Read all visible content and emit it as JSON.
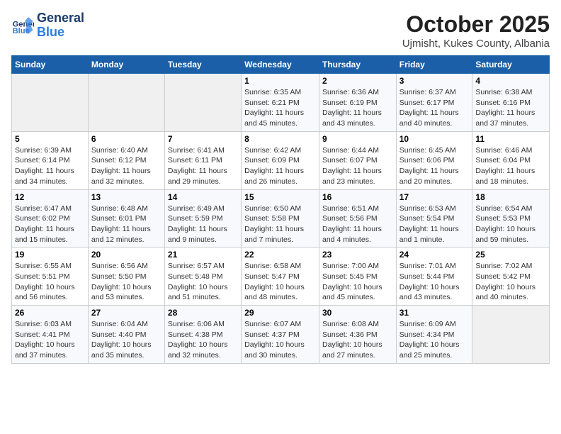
{
  "header": {
    "logo_general": "General",
    "logo_blue": "Blue",
    "title": "October 2025",
    "subtitle": "Ujmisht, Kukes County, Albania"
  },
  "weekdays": [
    "Sunday",
    "Monday",
    "Tuesday",
    "Wednesday",
    "Thursday",
    "Friday",
    "Saturday"
  ],
  "weeks": [
    [
      {
        "day": "",
        "info": ""
      },
      {
        "day": "",
        "info": ""
      },
      {
        "day": "",
        "info": ""
      },
      {
        "day": "1",
        "info": "Sunrise: 6:35 AM\nSunset: 6:21 PM\nDaylight: 11 hours and 45 minutes."
      },
      {
        "day": "2",
        "info": "Sunrise: 6:36 AM\nSunset: 6:19 PM\nDaylight: 11 hours and 43 minutes."
      },
      {
        "day": "3",
        "info": "Sunrise: 6:37 AM\nSunset: 6:17 PM\nDaylight: 11 hours and 40 minutes."
      },
      {
        "day": "4",
        "info": "Sunrise: 6:38 AM\nSunset: 6:16 PM\nDaylight: 11 hours and 37 minutes."
      }
    ],
    [
      {
        "day": "5",
        "info": "Sunrise: 6:39 AM\nSunset: 6:14 PM\nDaylight: 11 hours and 34 minutes."
      },
      {
        "day": "6",
        "info": "Sunrise: 6:40 AM\nSunset: 6:12 PM\nDaylight: 11 hours and 32 minutes."
      },
      {
        "day": "7",
        "info": "Sunrise: 6:41 AM\nSunset: 6:11 PM\nDaylight: 11 hours and 29 minutes."
      },
      {
        "day": "8",
        "info": "Sunrise: 6:42 AM\nSunset: 6:09 PM\nDaylight: 11 hours and 26 minutes."
      },
      {
        "day": "9",
        "info": "Sunrise: 6:44 AM\nSunset: 6:07 PM\nDaylight: 11 hours and 23 minutes."
      },
      {
        "day": "10",
        "info": "Sunrise: 6:45 AM\nSunset: 6:06 PM\nDaylight: 11 hours and 20 minutes."
      },
      {
        "day": "11",
        "info": "Sunrise: 6:46 AM\nSunset: 6:04 PM\nDaylight: 11 hours and 18 minutes."
      }
    ],
    [
      {
        "day": "12",
        "info": "Sunrise: 6:47 AM\nSunset: 6:02 PM\nDaylight: 11 hours and 15 minutes."
      },
      {
        "day": "13",
        "info": "Sunrise: 6:48 AM\nSunset: 6:01 PM\nDaylight: 11 hours and 12 minutes."
      },
      {
        "day": "14",
        "info": "Sunrise: 6:49 AM\nSunset: 5:59 PM\nDaylight: 11 hours and 9 minutes."
      },
      {
        "day": "15",
        "info": "Sunrise: 6:50 AM\nSunset: 5:58 PM\nDaylight: 11 hours and 7 minutes."
      },
      {
        "day": "16",
        "info": "Sunrise: 6:51 AM\nSunset: 5:56 PM\nDaylight: 11 hours and 4 minutes."
      },
      {
        "day": "17",
        "info": "Sunrise: 6:53 AM\nSunset: 5:54 PM\nDaylight: 11 hours and 1 minute."
      },
      {
        "day": "18",
        "info": "Sunrise: 6:54 AM\nSunset: 5:53 PM\nDaylight: 10 hours and 59 minutes."
      }
    ],
    [
      {
        "day": "19",
        "info": "Sunrise: 6:55 AM\nSunset: 5:51 PM\nDaylight: 10 hours and 56 minutes."
      },
      {
        "day": "20",
        "info": "Sunrise: 6:56 AM\nSunset: 5:50 PM\nDaylight: 10 hours and 53 minutes."
      },
      {
        "day": "21",
        "info": "Sunrise: 6:57 AM\nSunset: 5:48 PM\nDaylight: 10 hours and 51 minutes."
      },
      {
        "day": "22",
        "info": "Sunrise: 6:58 AM\nSunset: 5:47 PM\nDaylight: 10 hours and 48 minutes."
      },
      {
        "day": "23",
        "info": "Sunrise: 7:00 AM\nSunset: 5:45 PM\nDaylight: 10 hours and 45 minutes."
      },
      {
        "day": "24",
        "info": "Sunrise: 7:01 AM\nSunset: 5:44 PM\nDaylight: 10 hours and 43 minutes."
      },
      {
        "day": "25",
        "info": "Sunrise: 7:02 AM\nSunset: 5:42 PM\nDaylight: 10 hours and 40 minutes."
      }
    ],
    [
      {
        "day": "26",
        "info": "Sunrise: 6:03 AM\nSunset: 4:41 PM\nDaylight: 10 hours and 37 minutes."
      },
      {
        "day": "27",
        "info": "Sunrise: 6:04 AM\nSunset: 4:40 PM\nDaylight: 10 hours and 35 minutes."
      },
      {
        "day": "28",
        "info": "Sunrise: 6:06 AM\nSunset: 4:38 PM\nDaylight: 10 hours and 32 minutes."
      },
      {
        "day": "29",
        "info": "Sunrise: 6:07 AM\nSunset: 4:37 PM\nDaylight: 10 hours and 30 minutes."
      },
      {
        "day": "30",
        "info": "Sunrise: 6:08 AM\nSunset: 4:36 PM\nDaylight: 10 hours and 27 minutes."
      },
      {
        "day": "31",
        "info": "Sunrise: 6:09 AM\nSunset: 4:34 PM\nDaylight: 10 hours and 25 minutes."
      },
      {
        "day": "",
        "info": ""
      }
    ]
  ]
}
